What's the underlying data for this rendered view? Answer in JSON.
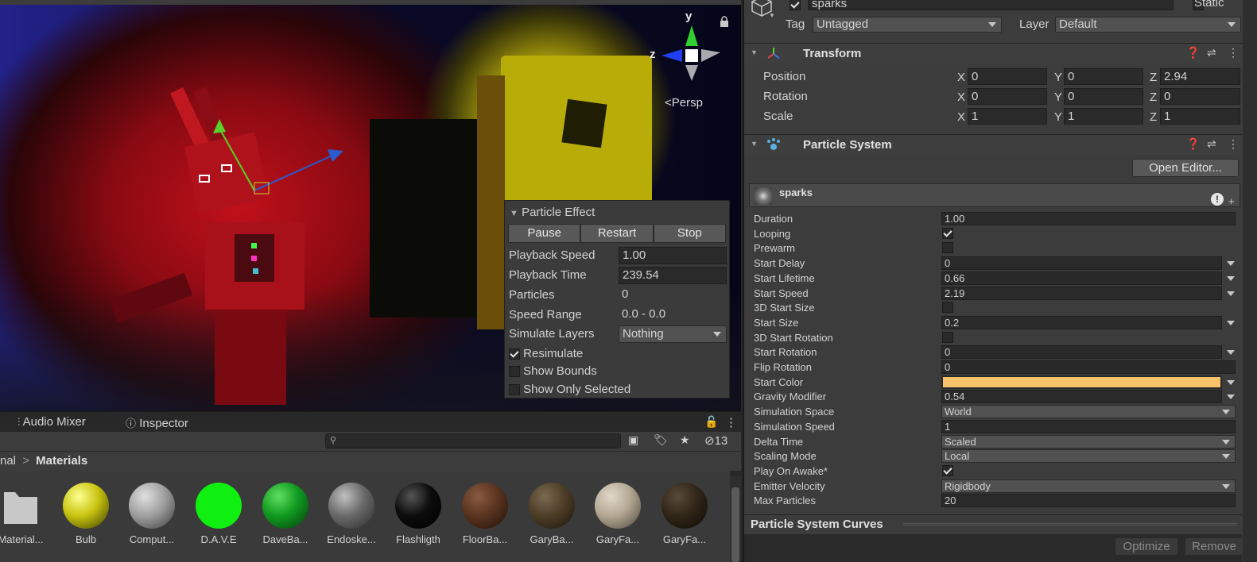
{
  "scene": {
    "persp_label": "Persp",
    "gizmo_axes": {
      "y": "y",
      "z": "z"
    }
  },
  "particle_effect": {
    "title": "Particle Effect",
    "buttons": [
      "Pause",
      "Restart",
      "Stop"
    ],
    "playback_speed_label": "Playback Speed",
    "playback_speed_value": "1.00",
    "playback_time_label": "Playback Time",
    "playback_time_value": "239.54",
    "particles_label": "Particles",
    "particles_value": "0",
    "speed_range_label": "Speed Range",
    "speed_range_value": "0.0 - 0.0",
    "simulate_layers_label": "Simulate Layers",
    "simulate_layers_value": "Nothing",
    "resimulate_label": "Resimulate",
    "resimulate_checked": true,
    "show_bounds_label": "Show Bounds",
    "show_bounds_checked": false,
    "show_only_selected_label": "Show Only Selected",
    "show_only_selected_checked": false
  },
  "bottom_tabs": {
    "audio_mixer": "Audio Mixer",
    "inspector": "Inspector",
    "hidden_count": "13"
  },
  "breadcrumb": {
    "parent": "nal",
    "separator": ">",
    "current": "Materials"
  },
  "assets": [
    {
      "name": "Material...",
      "type": "folder"
    },
    {
      "name": "Bulb",
      "color": "#c8c410"
    },
    {
      "name": "Comput...",
      "color": "#a0a0a0"
    },
    {
      "name": "D.A.V.E",
      "color": "#10f010"
    },
    {
      "name": "DaveBa...",
      "color": "#109a20"
    },
    {
      "name": "Endoske...",
      "color": "#7a7a7a"
    },
    {
      "name": "Flashligth",
      "color": "#0c0c0c"
    },
    {
      "name": "FloorBa...",
      "color": "#5a3420"
    },
    {
      "name": "GaryBa...",
      "color": "#4e3e28"
    },
    {
      "name": "GaryFa...",
      "color": "#bcb09e"
    },
    {
      "name": "GaryFa...",
      "color": "#302618"
    }
  ],
  "inspector": {
    "object_name": "sparks",
    "static_label": "Static",
    "tag_label": "Tag",
    "tag_value": "Untagged",
    "layer_label": "Layer",
    "layer_value": "Default",
    "transform": {
      "title": "Transform",
      "position_label": "Position",
      "rotation_label": "Rotation",
      "scale_label": "Scale",
      "axis_x": "X",
      "axis_y": "Y",
      "axis_z": "Z",
      "position": [
        "0",
        "0",
        "2.94"
      ],
      "rotation": [
        "0",
        "0",
        "0"
      ],
      "scale": [
        "1",
        "1",
        "1"
      ]
    },
    "particle_system": {
      "title": "Particle System",
      "open_editor": "Open Editor...",
      "module_name": "sparks",
      "props": [
        {
          "label": "Duration",
          "kind": "field",
          "value": "1.00"
        },
        {
          "label": "Looping",
          "kind": "check",
          "checked": true
        },
        {
          "label": "Prewarm",
          "kind": "check",
          "checked": false
        },
        {
          "label": "Start Delay",
          "kind": "field-dd",
          "value": "0"
        },
        {
          "label": "Start Lifetime",
          "kind": "field-dd",
          "value": "0.66"
        },
        {
          "label": "Start Speed",
          "kind": "field-dd",
          "value": "2.19"
        },
        {
          "label": "3D Start Size",
          "kind": "check",
          "checked": false
        },
        {
          "label": "Start Size",
          "kind": "field-dd",
          "value": "0.2"
        },
        {
          "label": "3D Start Rotation",
          "kind": "check",
          "checked": false
        },
        {
          "label": "Start Rotation",
          "kind": "field-dd",
          "value": "0"
        },
        {
          "label": "Flip Rotation",
          "kind": "field",
          "value": "0"
        },
        {
          "label": "Start Color",
          "kind": "color",
          "color": "#f6c36a"
        },
        {
          "label": "Gravity Modifier",
          "kind": "field-dd",
          "value": "0.54"
        },
        {
          "label": "Simulation Space",
          "kind": "dropdown",
          "value": "World"
        },
        {
          "label": "Simulation Speed",
          "kind": "field",
          "value": "1"
        },
        {
          "label": "Delta Time",
          "kind": "dropdown",
          "value": "Scaled"
        },
        {
          "label": "Scaling Mode",
          "kind": "dropdown",
          "value": "Local"
        },
        {
          "label": "Play On Awake*",
          "kind": "check",
          "checked": true
        },
        {
          "label": "Emitter Velocity",
          "kind": "dropdown",
          "value": "Rigidbody"
        },
        {
          "label": "Max Particles",
          "kind": "field",
          "value": "20"
        }
      ]
    },
    "curves_title": "Particle System Curves",
    "optimize": "Optimize",
    "remove": "Remove"
  }
}
